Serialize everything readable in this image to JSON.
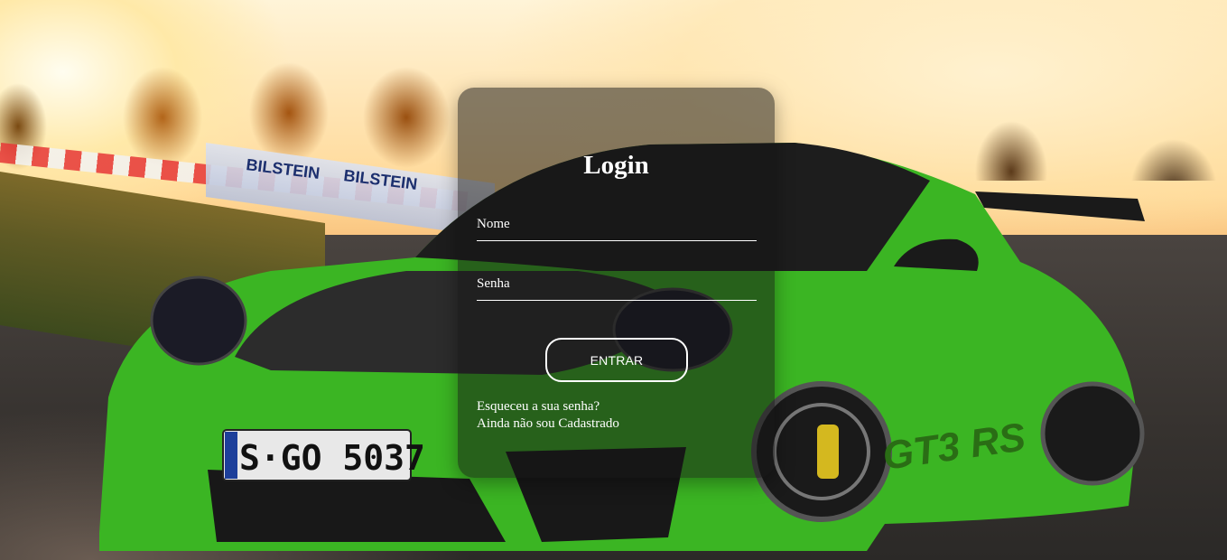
{
  "login": {
    "title": "Login",
    "name_label": "Nome",
    "password_label": "Senha",
    "submit_label": "ENTRAR",
    "forgot_link": "Esqueceu a sua senha?",
    "register_link": "Ainda não sou Cadastrado"
  },
  "background": {
    "plate_text": "S·GO 5037",
    "banner_text": "BILSTEIN",
    "car_badge_text": "GT3 RS"
  },
  "colors": {
    "card_overlay": "#161616",
    "text": "#ffffff",
    "car_green": "#3bb523"
  }
}
